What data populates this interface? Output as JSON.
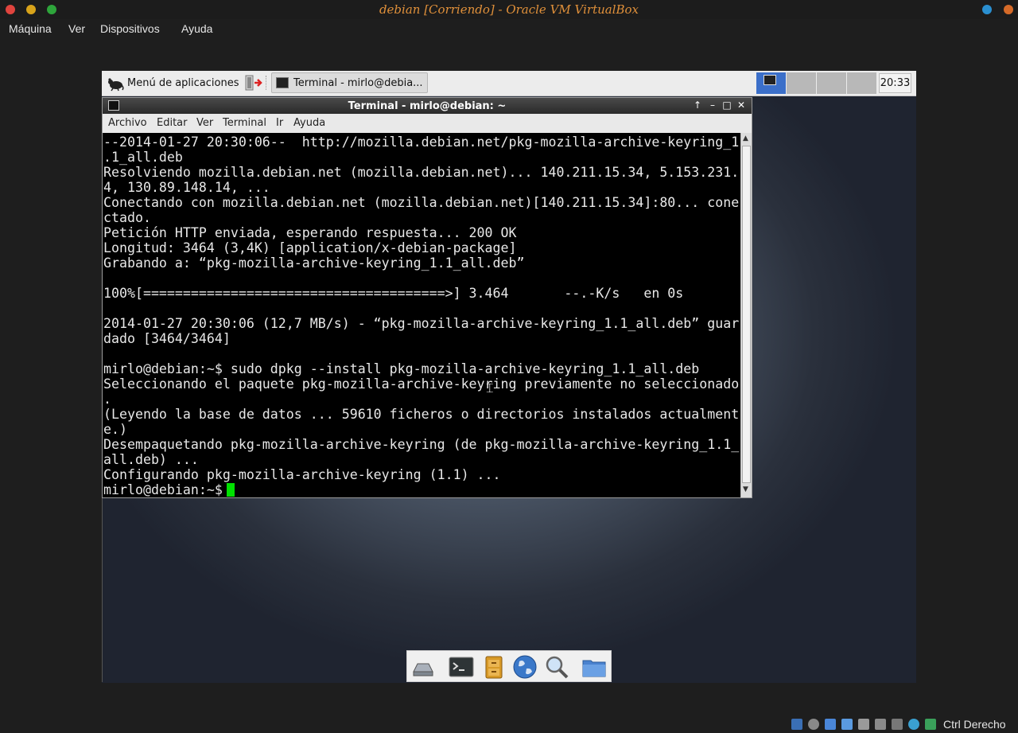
{
  "host": {
    "title": "debian [Corriendo] - Oracle VM VirtualBox",
    "menu": [
      "Máquina",
      "Ver",
      "Dispositivos",
      "Ayuda"
    ],
    "host_key_label": "Ctrl Derecho",
    "traffic_lights": [
      "#e0443e",
      "#d8a31a",
      "#2ea53b"
    ],
    "status_icons": [
      "hard-disk-icon",
      "optical-drive-icon",
      "usb-icon",
      "network-icon",
      "shared-folders-icon",
      "video-capture-icon",
      "display-icon",
      "mouse-integration-icon",
      "keyboard-capture-icon"
    ]
  },
  "panel": {
    "apps_menu_label": "Menú de aplicaciones",
    "task_button_label": "Terminal - mirlo@debia...",
    "workspaces": 4,
    "active_workspace": 1,
    "clock": "20:33"
  },
  "terminal": {
    "title": "Terminal - mirlo@debian: ~",
    "menu": [
      "Archivo",
      "Editar",
      "Ver",
      "Terminal",
      "Ir",
      "Ayuda"
    ],
    "lines": [
      "--2014-01-27 20:30:06--  http://mozilla.debian.net/pkg-mozilla-archive-keyring_1",
      ".1_all.deb",
      "Resolviendo mozilla.debian.net (mozilla.debian.net)... 140.211.15.34, 5.153.231.",
      "4, 130.89.148.14, ...",
      "Conectando con mozilla.debian.net (mozilla.debian.net)[140.211.15.34]:80... cone",
      "ctado.",
      "Petición HTTP enviada, esperando respuesta... 200 OK",
      "Longitud: 3464 (3,4K) [application/x-debian-package]",
      "Grabando a: “pkg-mozilla-archive-keyring_1.1_all.deb”",
      "",
      "100%[======================================>] 3.464       --.-K/s   en 0s",
      "",
      "2014-01-27 20:30:06 (12,7 MB/s) - “pkg-mozilla-archive-keyring_1.1_all.deb” guar",
      "dado [3464/3464]",
      "",
      "mirlo@debian:~$ sudo dpkg --install pkg-mozilla-archive-keyring_1.1_all.deb",
      "Seleccionando el paquete pkg-mozilla-archive-keyring previamente no seleccionado",
      ".",
      "(Leyendo la base de datos ... 59610 ficheros o directorios instalados actualment",
      "e.)",
      "Desempaquetando pkg-mozilla-archive-keyring (de pkg-mozilla-archive-keyring_1.1_",
      "all.deb) ...",
      "Configurando pkg-mozilla-archive-keyring (1.1) ..."
    ],
    "prompt": "mirlo@debian:~$"
  },
  "dock": [
    "drive-icon",
    "terminal-icon",
    "file-cabinet-icon",
    "web-browser-icon",
    "search-icon",
    "folder-icon"
  ]
}
